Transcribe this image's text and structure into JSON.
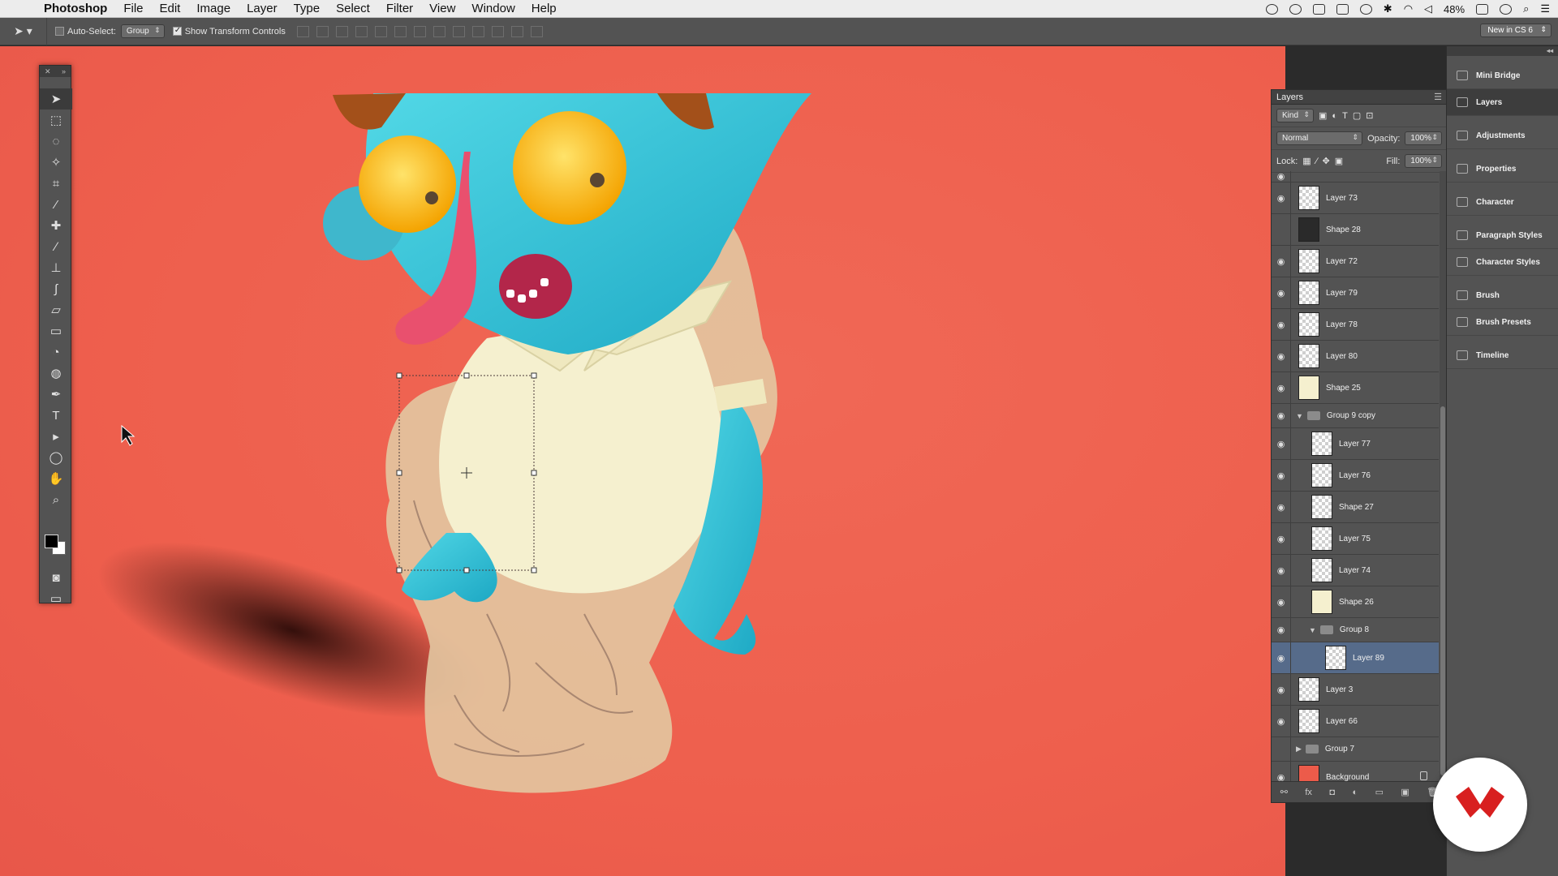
{
  "menubar": {
    "app_name": "Photoshop",
    "items": [
      "File",
      "Edit",
      "Image",
      "Layer",
      "Type",
      "Select",
      "Filter",
      "View",
      "Window",
      "Help"
    ],
    "battery": "48%"
  },
  "options_bar": {
    "auto_select_label": "Auto-Select:",
    "auto_select_value": "Group",
    "show_transform_label": "Show Transform Controls",
    "workspace": "New in CS 6"
  },
  "layers_panel": {
    "title": "Layers",
    "filter_kind": "Kind",
    "blend_mode": "Normal",
    "opacity_label": "Opacity:",
    "opacity_value": "100%",
    "lock_label": "Lock:",
    "fill_label": "Fill:",
    "fill_value": "100%",
    "layers": [
      {
        "name": "Layer 73",
        "visible": true,
        "indent": 0
      },
      {
        "name": "Shape 28",
        "visible": false,
        "indent": 0
      },
      {
        "name": "Layer 72",
        "visible": true,
        "indent": 0
      },
      {
        "name": "Layer 79",
        "visible": true,
        "indent": 0
      },
      {
        "name": "Layer 78",
        "visible": true,
        "indent": 0
      },
      {
        "name": "Layer 80",
        "visible": true,
        "indent": 0
      },
      {
        "name": "Shape 25",
        "visible": true,
        "indent": 0
      },
      {
        "name": "Group 9 copy",
        "visible": true,
        "indent": 0
      },
      {
        "name": "Layer 77",
        "visible": true,
        "indent": 1
      },
      {
        "name": "Layer 76",
        "visible": true,
        "indent": 1
      },
      {
        "name": "Shape 27",
        "visible": true,
        "indent": 1
      },
      {
        "name": "Layer 75",
        "visible": true,
        "indent": 1
      },
      {
        "name": "Layer 74",
        "visible": true,
        "indent": 1
      },
      {
        "name": "Shape 26",
        "visible": true,
        "indent": 1
      },
      {
        "name": "Group 8",
        "visible": true,
        "indent": 1
      },
      {
        "name": "Layer 89",
        "visible": true,
        "indent": 2
      },
      {
        "name": "Layer 3",
        "visible": true,
        "indent": 0
      },
      {
        "name": "Layer 66",
        "visible": true,
        "indent": 0
      },
      {
        "name": "Group 7",
        "visible": false,
        "indent": 0
      },
      {
        "name": "Background",
        "visible": true,
        "indent": 0
      }
    ]
  },
  "dock": {
    "items": [
      "Mini Bridge",
      "Layers",
      "Adjustments",
      "Properties",
      "Character",
      "Paragraph Styles",
      "Character Styles",
      "Brush",
      "Brush Presets",
      "Timeline"
    ]
  },
  "colors": {
    "canvas_bg": "#ee5f4d",
    "monster_skin": "#36c6d8",
    "shirt": "#f5f0cf",
    "selected_layer": "#566b8a"
  }
}
